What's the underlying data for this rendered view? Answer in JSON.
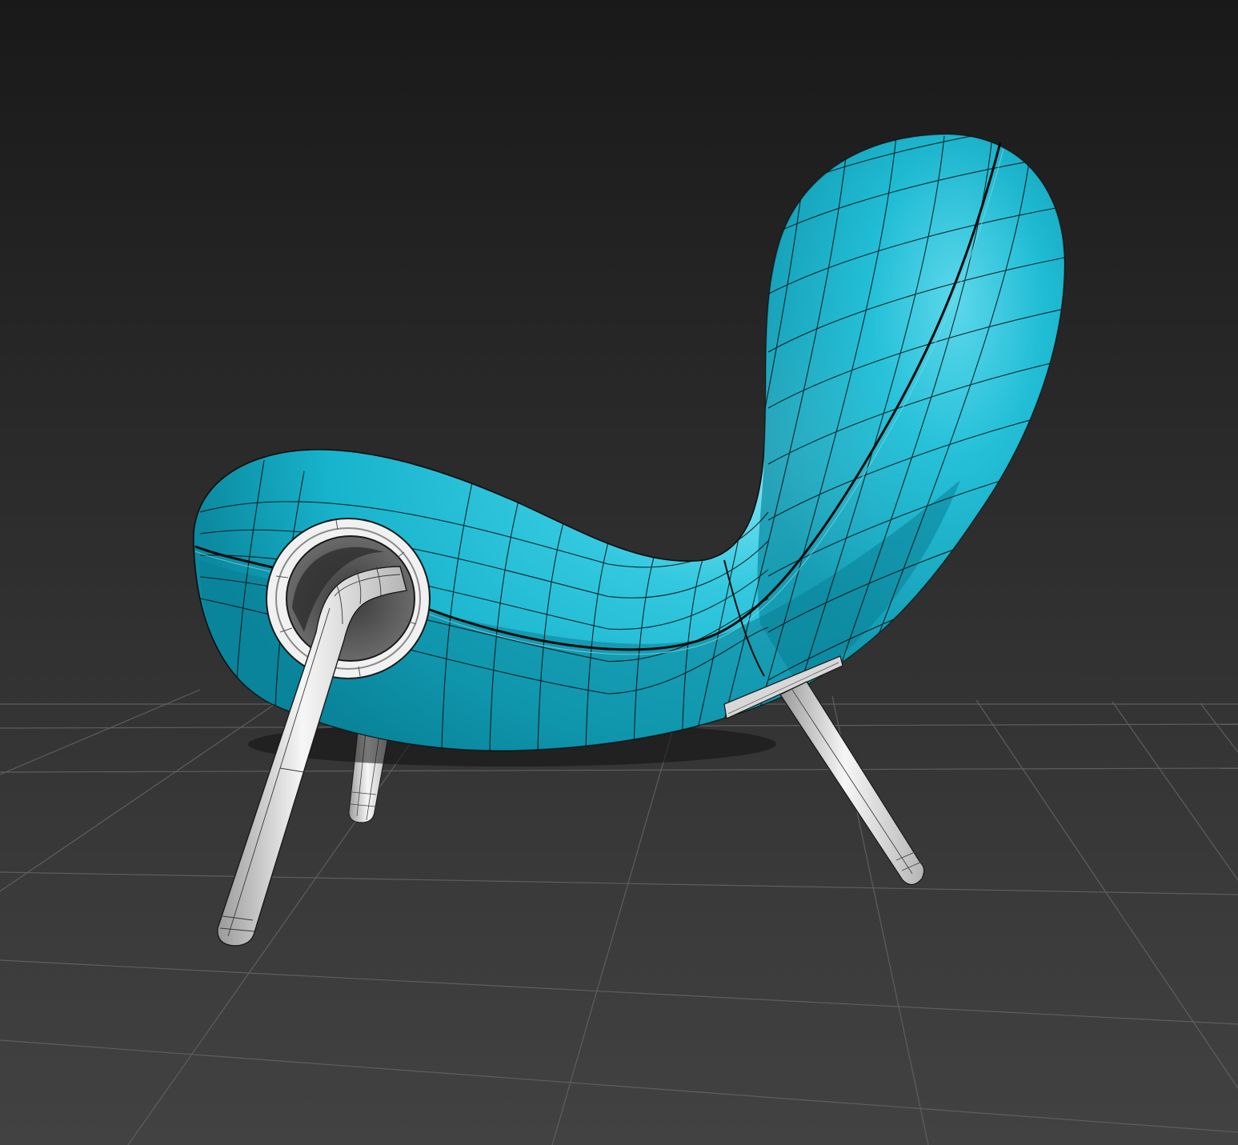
{
  "viewport": {
    "background_top": "#191919",
    "background_bottom": "#424242",
    "grid_color": "#5e5e5e"
  },
  "model": {
    "shell_color": "#18b3cc",
    "shell_highlight": "#8ae9f7",
    "shell_shadow": "#086e80",
    "wire_color": "#111111",
    "leg_color": "#ececec",
    "leg_shade": "#9a9a9a",
    "ring_color": "#f2f2f2"
  }
}
